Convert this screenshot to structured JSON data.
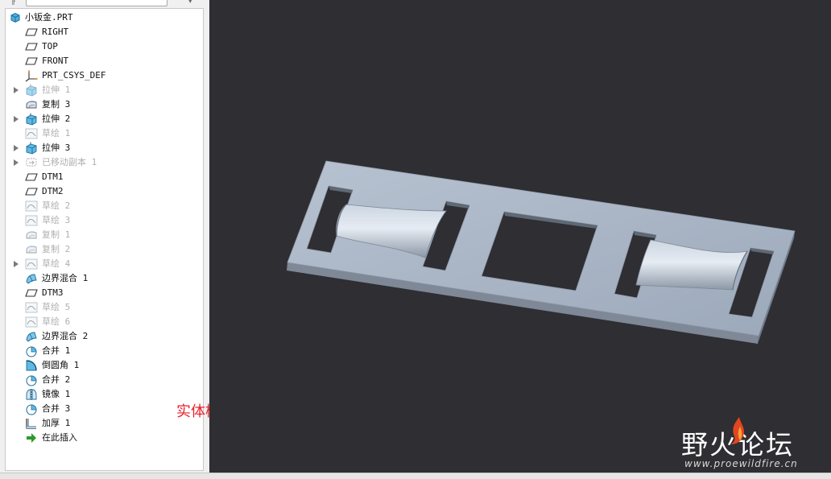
{
  "model_tree": {
    "root": "小钣金.PRT",
    "items": [
      {
        "label": "RIGHT",
        "icon": "datum-plane-icon",
        "suppressed": false,
        "expandable": false
      },
      {
        "label": "TOP",
        "icon": "datum-plane-icon",
        "suppressed": false,
        "expandable": false
      },
      {
        "label": "FRONT",
        "icon": "datum-plane-icon",
        "suppressed": false,
        "expandable": false
      },
      {
        "label": "PRT_CSYS_DEF",
        "icon": "csys-icon",
        "suppressed": false,
        "expandable": false
      },
      {
        "label": "拉伸 1",
        "icon": "extrude-icon",
        "suppressed": true,
        "expandable": true
      },
      {
        "label": "复制 3",
        "icon": "copy-surface-icon",
        "suppressed": false,
        "expandable": false
      },
      {
        "label": "拉伸 2",
        "icon": "extrude-icon",
        "suppressed": false,
        "expandable": true
      },
      {
        "label": "草绘 1",
        "icon": "sketch-icon",
        "suppressed": true,
        "expandable": false
      },
      {
        "label": "拉伸 3",
        "icon": "extrude-icon",
        "suppressed": false,
        "expandable": true
      },
      {
        "label": "已移动副本 1",
        "icon": "moved-copy-icon",
        "suppressed": true,
        "expandable": true
      },
      {
        "label": "DTM1",
        "icon": "datum-plane-icon",
        "suppressed": false,
        "expandable": false
      },
      {
        "label": "DTM2",
        "icon": "datum-plane-icon",
        "suppressed": false,
        "expandable": false
      },
      {
        "label": "草绘 2",
        "icon": "sketch-icon",
        "suppressed": true,
        "expandable": false
      },
      {
        "label": "草绘 3",
        "icon": "sketch-icon",
        "suppressed": true,
        "expandable": false
      },
      {
        "label": "复制 1",
        "icon": "copy-surface-icon",
        "suppressed": true,
        "expandable": false
      },
      {
        "label": "复制 2",
        "icon": "copy-surface-icon",
        "suppressed": true,
        "expandable": false
      },
      {
        "label": "草绘 4",
        "icon": "sketch-icon",
        "suppressed": true,
        "expandable": true
      },
      {
        "label": "边界混合 1",
        "icon": "boundary-blend-icon",
        "suppressed": false,
        "expandable": false
      },
      {
        "label": "DTM3",
        "icon": "datum-plane-icon",
        "suppressed": false,
        "expandable": false
      },
      {
        "label": "草绘 5",
        "icon": "sketch-icon",
        "suppressed": true,
        "expandable": false
      },
      {
        "label": "草绘 6",
        "icon": "sketch-icon",
        "suppressed": true,
        "expandable": false
      },
      {
        "label": "边界混合 2",
        "icon": "boundary-blend-icon",
        "suppressed": false,
        "expandable": false
      },
      {
        "label": "合并 1",
        "icon": "merge-icon",
        "suppressed": false,
        "expandable": false
      },
      {
        "label": "倒圆角 1",
        "icon": "round-icon",
        "suppressed": false,
        "expandable": false
      },
      {
        "label": "合并 2",
        "icon": "merge-icon",
        "suppressed": false,
        "expandable": false
      },
      {
        "label": "镜像 1",
        "icon": "mirror-icon",
        "suppressed": false,
        "expandable": false
      },
      {
        "label": "合并 3",
        "icon": "merge-icon",
        "suppressed": false,
        "expandable": false
      },
      {
        "label": "加厚 1",
        "icon": "thicken-icon",
        "suppressed": false,
        "expandable": false
      },
      {
        "label": "在此插入",
        "icon": "insert-here-icon",
        "suppressed": false,
        "expandable": false
      }
    ]
  },
  "annotation": "实体模式",
  "watermark": {
    "title": "野火论坛",
    "url": "www.proewildfire.cn"
  },
  "colors": {
    "viewport_background": "#2e2e33",
    "part_face": "#a9b5c5",
    "part_edge": "#76808d",
    "annotation_text": "#e8202a",
    "suppressed_text": "#b0b0b0"
  }
}
